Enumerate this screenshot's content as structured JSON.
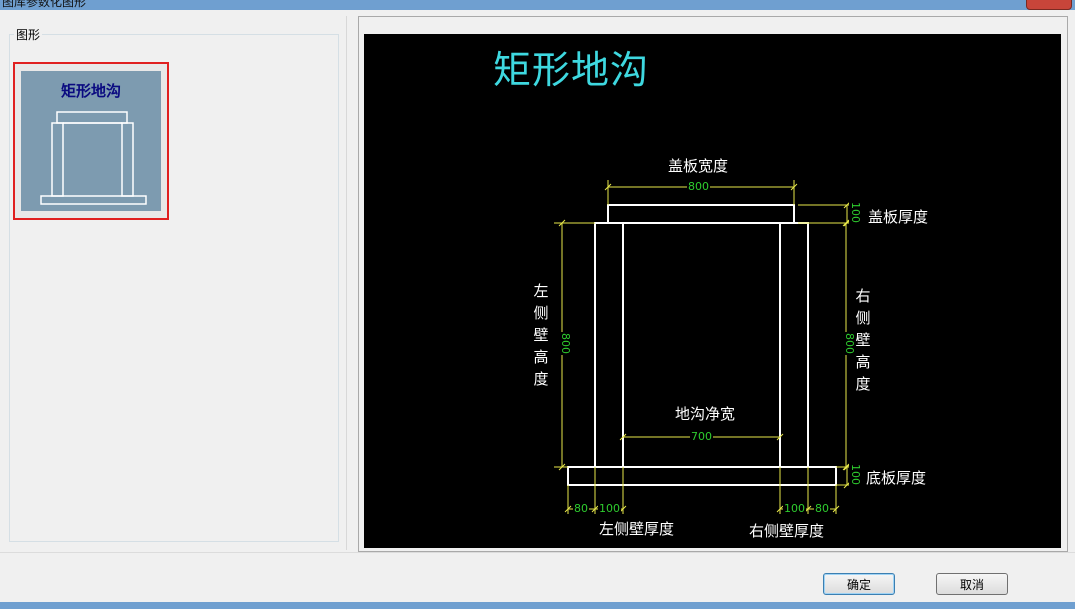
{
  "window": {
    "title": "图库参数化图形"
  },
  "left": {
    "group_label": "图形",
    "thumbnail": {
      "title": "矩形地沟"
    }
  },
  "preview": {
    "title": "矩形地沟",
    "labels": {
      "cover_width": "盖板宽度",
      "cover_thickness": "盖板厚度",
      "left_wall_height": [
        "左",
        "侧",
        "壁",
        "高",
        "度"
      ],
      "right_wall_height": [
        "右",
        "侧",
        "壁",
        "高",
        "度"
      ],
      "clear_width": "地沟净宽",
      "bottom_thickness": "底板厚度",
      "left_wall_thickness": "左侧壁厚度",
      "right_wall_thickness": "右侧壁厚度"
    },
    "dims": {
      "cover_width": "800",
      "cover_thickness": "100",
      "left_wall_height": "800",
      "right_wall_height": "800",
      "clear_width": "700",
      "bottom_thickness": "100",
      "left_offset": "80",
      "left_wall": "100",
      "right_wall": "100",
      "right_offset": "80"
    },
    "colors": {
      "title": "#3ed8e0",
      "dimension": "#2ecc2e",
      "extension": "#e8e84a",
      "outline": "#ffffff"
    }
  },
  "buttons": {
    "ok": "确定",
    "cancel": "取消"
  }
}
